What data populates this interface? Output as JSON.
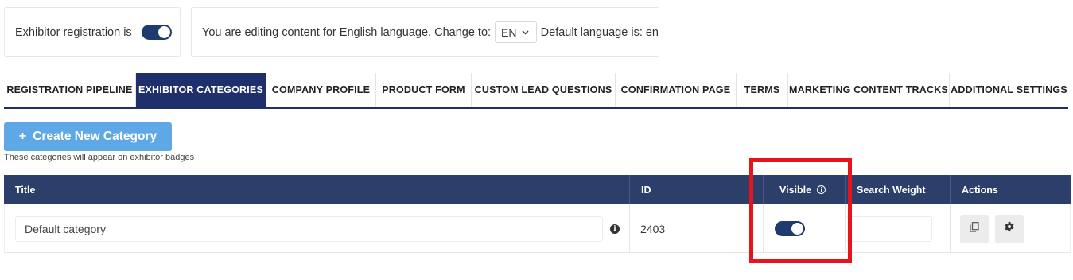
{
  "registration": {
    "label": "Exhibitor registration is",
    "enabled": true
  },
  "language": {
    "prefix": "You are editing content for English language. Change to:",
    "selected": "EN",
    "default_label": "Default language is: en"
  },
  "tabs": [
    {
      "label": "REGISTRATION PIPELINE",
      "active": false
    },
    {
      "label": "EXHIBITOR CATEGORIES",
      "active": true
    },
    {
      "label": "COMPANY PROFILE",
      "active": false
    },
    {
      "label": "PRODUCT FORM",
      "active": false
    },
    {
      "label": "CUSTOM LEAD QUESTIONS",
      "active": false
    },
    {
      "label": "CONFIRMATION PAGE",
      "active": false
    },
    {
      "label": "TERMS",
      "active": false
    },
    {
      "label": "MARKETING CONTENT TRACKS",
      "active": false
    },
    {
      "label": "ADDITIONAL SETTINGS",
      "active": false
    }
  ],
  "create_button": {
    "plus": "+",
    "label": "Create New Category"
  },
  "hint": "These categories will appear on exhibitor badges",
  "table": {
    "columns": {
      "title": "Title",
      "id": "ID",
      "visible": "Visible",
      "search_weight": "Search Weight",
      "actions": "Actions"
    },
    "rows": [
      {
        "title": "Default category",
        "id": "2403",
        "visible": true,
        "search_weight": ""
      }
    ]
  },
  "icons": {
    "info_header": "info-circle-icon",
    "info_row": "info-icon",
    "copy": "copy-icon",
    "settings": "gear-icon",
    "chevron": "chevron-down-icon"
  },
  "colors": {
    "primary": "#1e2f6b",
    "table_header": "#2c3e6a",
    "create_button": "#5fa8e8",
    "highlight": "#e8141c"
  }
}
